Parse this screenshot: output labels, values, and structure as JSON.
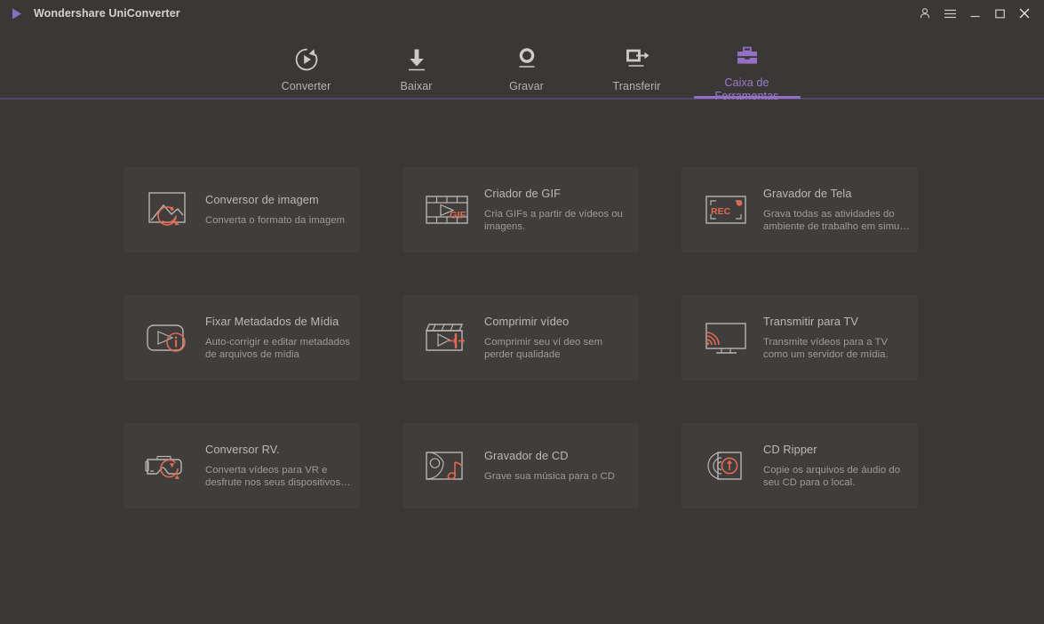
{
  "window": {
    "title": "Wondershare UniConverter",
    "logo_icon": "play-triangle-logo",
    "controls": [
      {
        "name": "account-button",
        "icon": "person-icon"
      },
      {
        "name": "menu-button",
        "icon": "hamburger-menu-icon"
      },
      {
        "name": "minimize-button",
        "icon": "minimize-icon"
      },
      {
        "name": "maximize-button",
        "icon": "maximize-icon"
      },
      {
        "name": "close-button",
        "icon": "close-icon"
      }
    ]
  },
  "colors": {
    "page_bg": "#3a3737",
    "card_bg": "#403d3d",
    "accent_purple": "#9470c4",
    "rule_purple": "#52466a",
    "accent_red": "#e06a50",
    "text_primary": "#bdb8b8",
    "text_secondary": "#a09b9b"
  },
  "nav": {
    "tabs": [
      {
        "label": "Converter",
        "icon": "convert-circle-play-icon",
        "active": false
      },
      {
        "label": "Baixar",
        "icon": "download-arrow-icon",
        "active": false
      },
      {
        "label": "Gravar",
        "icon": "record-dot-icon",
        "active": false
      },
      {
        "label": "Transferir",
        "icon": "transfer-device-arrow-icon",
        "active": false
      },
      {
        "label": "Caixa de Ferramentas",
        "icon": "toolbox-icon",
        "active": true
      }
    ]
  },
  "toolbox": {
    "cards": [
      {
        "title": "Conversor de imagem",
        "desc": "Converta o formato da imagem",
        "icon": "image-convert-icon",
        "name": "card-image-converter"
      },
      {
        "title": "Criador de GIF",
        "desc": "Cria GIFs a partir de vídeos ou imagens.",
        "icon": "gif-maker-icon",
        "name": "card-gif-maker"
      },
      {
        "title": "Gravador de Tela",
        "desc": "Grava todas as atividades do ambiente de trabalho em simu…",
        "icon": "screen-recorder-icon",
        "name": "card-screen-recorder"
      },
      {
        "title": "Fixar Metadados de Mídia",
        "desc": "Auto-corrigir e editar metadados de arquivos de mídia",
        "icon": "media-metadata-icon",
        "name": "card-media-metadata"
      },
      {
        "title": "Comprimir vídeo",
        "desc": "Comprimir seu ví deo sem perder qualidade",
        "icon": "compress-video-icon",
        "name": "card-compress-video"
      },
      {
        "title": "Transmitir para TV",
        "desc": "Transmite vídeos para a TV como um servidor de mídia.",
        "icon": "cast-tv-icon",
        "name": "card-cast-to-tv"
      },
      {
        "title": "Conversor RV.",
        "desc": "Converta vídeos para VR e desfrute nos seus dispositivos…",
        "icon": "vr-converter-icon",
        "name": "card-vr-converter"
      },
      {
        "title": "Gravador de CD",
        "desc": "Grave sua música para o CD",
        "icon": "cd-burner-icon",
        "name": "card-cd-burner"
      },
      {
        "title": "CD Ripper",
        "desc": "Copie os arquivos de áudio do seu CD para o local.",
        "icon": "cd-ripper-icon",
        "name": "card-cd-ripper"
      }
    ]
  }
}
